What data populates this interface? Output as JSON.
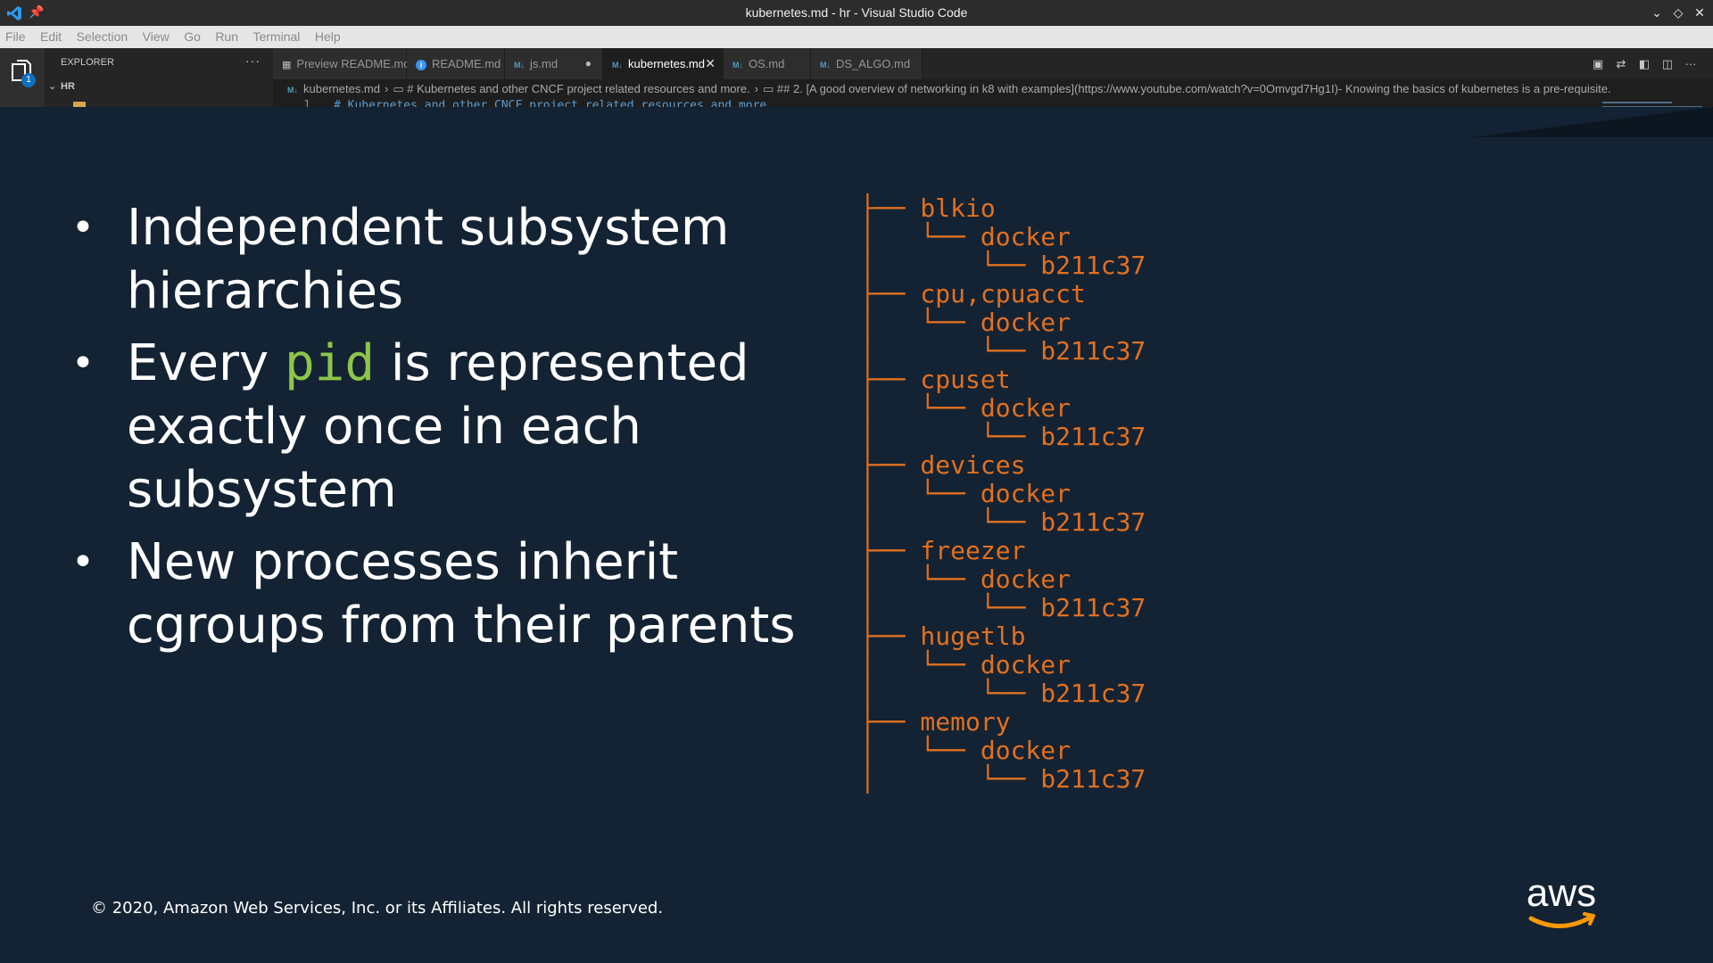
{
  "window": {
    "title": "kubernetes.md - hr - Visual Studio Code",
    "controls": [
      "⌄",
      "◇",
      "✕"
    ]
  },
  "menu": [
    "File",
    "Edit",
    "Selection",
    "View",
    "Go",
    "Run",
    "Terminal",
    "Help"
  ],
  "activity": {
    "badge": "1"
  },
  "sidebar": {
    "title": "EXPLORER",
    "folder": "HR"
  },
  "tabs": [
    {
      "label": "Preview README.md"
    },
    {
      "label": "README.md"
    },
    {
      "label": "js.md"
    },
    {
      "label": "kubernetes.md"
    },
    {
      "label": "OS.md"
    },
    {
      "label": "DS_ALGO.md"
    }
  ],
  "breadcrumb": {
    "file": "kubernetes.md",
    "h1": "# Kubernetes and other CNCF project related resources and more.",
    "h2": "## 2. [A good overview of networking in k8 with examples](https://www.youtube.com/watch?v=0Omvgd7Hg1I)- Knowing the basics of kubernetes is a pre-requisite."
  },
  "editor": {
    "line_number": "1",
    "first_line": "# Kubernetes and other CNCF project related resources and more."
  },
  "slide": {
    "bullets": [
      {
        "before": "Independent subsystem hierarchies",
        "code": "",
        "after": ""
      },
      {
        "before": "Every ",
        "code": "pid",
        "after": " is represented exactly once in each subsystem"
      },
      {
        "before": "New processes inherit cgroups from their parents",
        "code": "",
        "after": ""
      }
    ],
    "tree": [
      "├── blkio",
      "│   └── docker",
      "│       └── b211c37",
      "├── cpu,cpuacct",
      "│   └── docker",
      "│       └── b211c37",
      "├── cpuset",
      "│   └── docker",
      "│       └── b211c37",
      "├── devices",
      "│   └── docker",
      "│       └── b211c37",
      "├── freezer",
      "│   └── docker",
      "│       └── b211c37",
      "├── hugetlb",
      "│   └── docker",
      "│       └── b211c37",
      "├── memory",
      "│   └── docker",
      "│       └── b211c37"
    ],
    "footer": "© 2020, Amazon Web Services, Inc. or its Affiliates. All rights reserved.",
    "logo_text": "aws"
  },
  "colors": {
    "slide_bg": "#132333",
    "tree_orange": "#e2701f",
    "code_green": "#8dc54b",
    "aws_orange": "#ff9900"
  }
}
